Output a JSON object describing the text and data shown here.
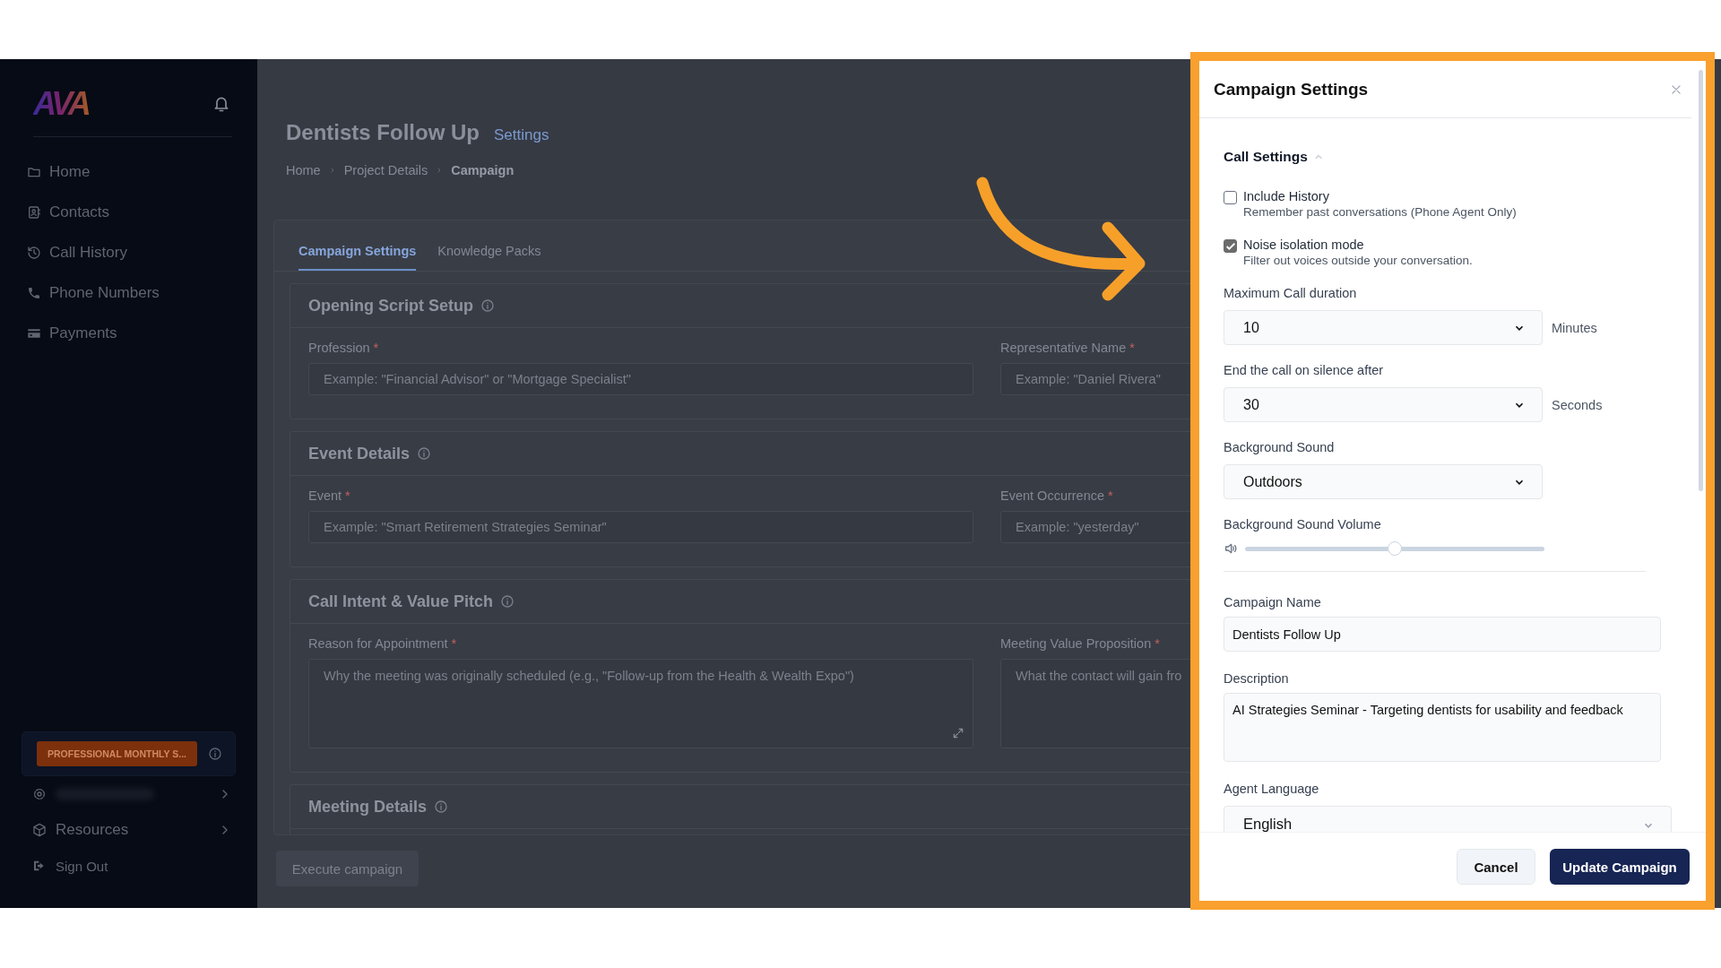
{
  "sidebar": {
    "logo": "AVA",
    "nav_items": [
      {
        "label": "Home"
      },
      {
        "label": "Contacts"
      },
      {
        "label": "Call History"
      },
      {
        "label": "Phone Numbers"
      },
      {
        "label": "Payments"
      }
    ],
    "plan_badge": "PROFESSIONAL MONTHLY S...",
    "bottom_items": [
      {
        "kind": "redacted",
        "submenu": true
      },
      {
        "kind": "link",
        "label": "Resources",
        "submenu": true
      },
      {
        "kind": "link",
        "label": "Sign Out",
        "submenu": false
      }
    ]
  },
  "main": {
    "title": "Dentists Follow Up",
    "title_link": "Settings",
    "breadcrumb": [
      {
        "label": "Home",
        "current": false
      },
      {
        "label": "Project Details",
        "current": false
      },
      {
        "label": "Campaign",
        "current": true
      }
    ],
    "tabs": [
      {
        "label": "Campaign Settings",
        "selected": true
      },
      {
        "label": "Knowledge Packs",
        "selected": false
      }
    ],
    "sections": [
      {
        "title": "Opening Script Setup",
        "fields": [
          {
            "kind": "input",
            "label": "Profession",
            "mark": "*",
            "placeholder": "Example: \"Financial Advisor\" or \"Mortgage Specialist\""
          },
          {
            "kind": "input",
            "label": "Representative Name",
            "mark": "*",
            "placeholder": "Example: \"Daniel Rivera\""
          }
        ]
      },
      {
        "title": "Event Details",
        "fields": [
          {
            "kind": "input",
            "label": "Event",
            "mark": "*",
            "placeholder": "Example: \"Smart Retirement Strategies Seminar\""
          },
          {
            "kind": "input",
            "label": "Event Occurrence",
            "mark": "*",
            "placeholder": "Example: \"yesterday\""
          }
        ]
      },
      {
        "title": "Call Intent & Value Pitch",
        "fields": [
          {
            "kind": "textarea",
            "label": "Reason for Appointment",
            "mark": "*",
            "placeholder": "Why the meeting was originally scheduled (e.g., \"Follow-up from the Health & Wealth Expo\")"
          },
          {
            "kind": "textarea",
            "label": "Meeting Value Proposition",
            "mark": "*",
            "placeholder": "What the contact will gain fro"
          }
        ]
      },
      {
        "title": "Meeting Details"
      }
    ],
    "execute_button": {
      "label": "Execute campaign",
      "disabled": true
    }
  },
  "panel": {
    "title": "Campaign Settings",
    "section": {
      "title": "Call Settings",
      "expanded": true
    },
    "checkboxes": [
      {
        "label": "Include History",
        "description": "Remember past conversations (Phone Agent Only)",
        "checked": false
      },
      {
        "label": "Noise isolation mode",
        "description": "Filter out voices outside your conversation.",
        "checked": true
      }
    ],
    "fields": [
      {
        "kind": "select",
        "label": "Maximum Call duration",
        "value": "10",
        "unit": "Minutes"
      },
      {
        "kind": "select",
        "label": "End the call on silence after",
        "value": "30",
        "unit": "Seconds"
      },
      {
        "kind": "select",
        "label": "Background Sound",
        "value": "Outdoors"
      },
      {
        "kind": "slider",
        "label": "Background Sound Volume",
        "level": 0.5
      },
      {
        "kind": "input",
        "label": "Campaign Name",
        "value": "Dentists Follow Up"
      },
      {
        "kind": "textarea",
        "label": "Description",
        "value": "AI Strategies Seminar - Targeting dentists for usability and feedback"
      },
      {
        "kind": "wide_select",
        "label": "Agent Language",
        "value": "English"
      }
    ],
    "buttons": [
      {
        "kind": "secondary",
        "label": "Cancel"
      },
      {
        "kind": "primary",
        "label": "Update Campaign"
      }
    ]
  }
}
